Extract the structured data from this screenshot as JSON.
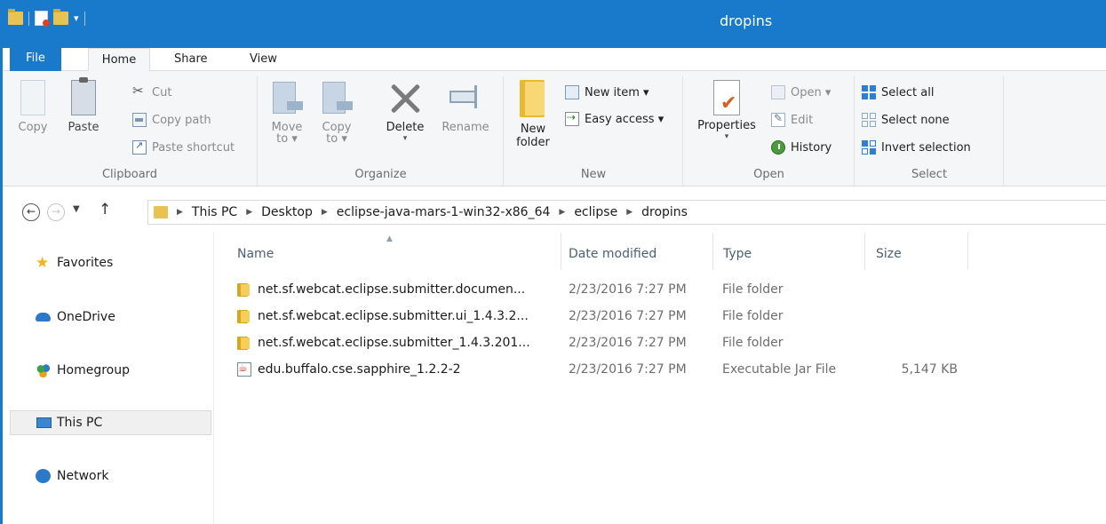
{
  "window": {
    "title": "dropins"
  },
  "tabs": [
    "File",
    "Home",
    "Share",
    "View"
  ],
  "ribbon": {
    "clipboard": {
      "label": "Clipboard",
      "copy": "Copy",
      "paste": "Paste",
      "cut": "Cut",
      "copy_path": "Copy path",
      "paste_shortcut": "Paste shortcut"
    },
    "organize": {
      "label": "Organize",
      "move_to": [
        "Move",
        "to ▾"
      ],
      "copy_to": [
        "Copy",
        "to ▾"
      ],
      "delete": "Delete",
      "rename": "Rename"
    },
    "new": {
      "label": "New",
      "new_folder": [
        "New",
        "folder"
      ],
      "new_item": "New item ▾",
      "easy_access": "Easy access ▾"
    },
    "open": {
      "label": "Open",
      "properties": "Properties",
      "open": "Open ▾",
      "edit": "Edit",
      "history": "History"
    },
    "select": {
      "label": "Select",
      "select_all": "Select all",
      "select_none": "Select none",
      "invert_selection": "Invert selection"
    }
  },
  "address": {
    "breadcrumbs": [
      "This PC",
      "Desktop",
      "eclipse-java-mars-1-win32-x86_64",
      "eclipse",
      "dropins"
    ]
  },
  "nav_pane": [
    {
      "label": "Favorites",
      "icon": "star-icon"
    },
    {
      "label": "OneDrive",
      "icon": "cloud-icon"
    },
    {
      "label": "Homegroup",
      "icon": "homegroup-icon"
    },
    {
      "label": "This PC",
      "icon": "computer-icon",
      "selected": true
    },
    {
      "label": "Network",
      "icon": "network-icon"
    }
  ],
  "columns": [
    "Name",
    "Date modified",
    "Type",
    "Size"
  ],
  "files": [
    {
      "name": "net.sf.webcat.eclipse.submitter.documen...",
      "date": "2/23/2016 7:27 PM",
      "type": "File folder",
      "size": "",
      "icon": "folder-icon"
    },
    {
      "name": "net.sf.webcat.eclipse.submitter.ui_1.4.3.2...",
      "date": "2/23/2016 7:27 PM",
      "type": "File folder",
      "size": "",
      "icon": "folder-icon"
    },
    {
      "name": "net.sf.webcat.eclipse.submitter_1.4.3.201...",
      "date": "2/23/2016 7:27 PM",
      "type": "File folder",
      "size": "",
      "icon": "folder-icon"
    },
    {
      "name": "edu.buffalo.cse.sapphire_1.2.2-2",
      "date": "2/23/2016 7:27 PM",
      "type": "Executable Jar File",
      "size": "5,147 KB",
      "icon": "jar-file-icon"
    }
  ]
}
